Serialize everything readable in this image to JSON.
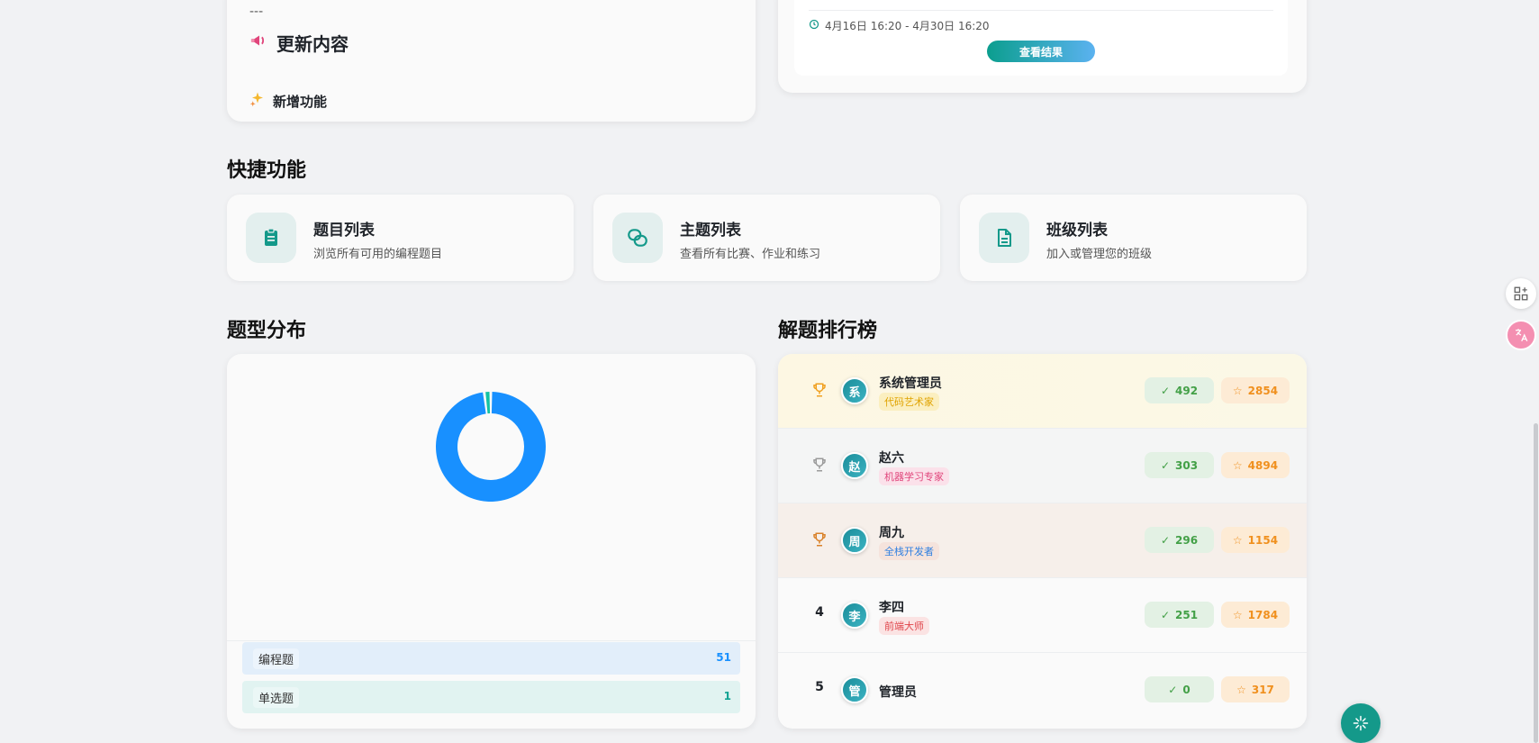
{
  "update": {
    "dashes": "---",
    "title": "更新内容",
    "subtitle": "新增功能",
    "title_icon": "megaphone-icon",
    "subtitle_icon": "sparkles-icon"
  },
  "exam": {
    "time": "4月16日 16:20 - 4月30日 16:20",
    "button": "查看结果"
  },
  "quick_section": {
    "title": "快捷功能",
    "items": [
      {
        "title": "题目列表",
        "desc": "浏览所有可用的编程题目",
        "icon": "clipboard-icon"
      },
      {
        "title": "主题列表",
        "desc": "查看所有比赛、作业和练习",
        "icon": "link-icon"
      },
      {
        "title": "班级列表",
        "desc": "加入或管理您的班级",
        "icon": "document-icon"
      }
    ]
  },
  "distribution": {
    "title": "题型分布",
    "items": [
      {
        "label": "编程题",
        "value": "51",
        "color": "#1890ff"
      },
      {
        "label": "单选题",
        "value": "1",
        "color": "#13c2a3"
      }
    ]
  },
  "chart_data": {
    "type": "pie",
    "categories": [
      "编程题",
      "单选题"
    ],
    "values": [
      51,
      1
    ],
    "colors": [
      "#1890ff",
      "#13c2a3"
    ]
  },
  "leaderboard": {
    "title": "解题排行榜",
    "rows": [
      {
        "rank": "",
        "rank_icon": "trophy-icon",
        "trophy_color": "#f0a020",
        "avatar": "系",
        "name": "系统管理员",
        "tag": "代码艺术家",
        "tag_color": "#e0a300",
        "tag_bg": "#fbefc0",
        "solved": "492",
        "score": "2854",
        "bg": "linear-gradient(90deg,#fdf7e3,#fbf8e6)"
      },
      {
        "rank": "",
        "rank_icon": "trophy-icon",
        "trophy_color": "#9a9a9a",
        "avatar": "赵",
        "name": "赵六",
        "tag": "机器学习专家",
        "tag_color": "#e0457b",
        "tag_bg": "#fbe1ea",
        "solved": "303",
        "score": "4894",
        "bg": "#f4f5f5"
      },
      {
        "rank": "",
        "rank_icon": "trophy-icon",
        "trophy_color": "#d9822b",
        "avatar": "周",
        "name": "周九",
        "tag": "全栈开发者",
        "tag_color": "#2f7fe0",
        "tag_bg": "#f5e3dc",
        "solved": "296",
        "score": "1154",
        "bg": "#f6efea"
      },
      {
        "rank": "4",
        "avatar": "李",
        "name": "李四",
        "tag": "前端大师",
        "tag_color": "#e0454b",
        "tag_bg": "#fbe3e3",
        "solved": "251",
        "score": "1784",
        "bg": "#fafafa"
      },
      {
        "rank": "5",
        "avatar": "管",
        "name": "管理员",
        "tag": "",
        "solved": "0",
        "score": "317",
        "bg": "#fafafa"
      }
    ]
  },
  "side": {
    "apps_icon": "apps-add-icon",
    "translate_icon": "translate-icon",
    "fab_icon": "sparkle-icon"
  }
}
